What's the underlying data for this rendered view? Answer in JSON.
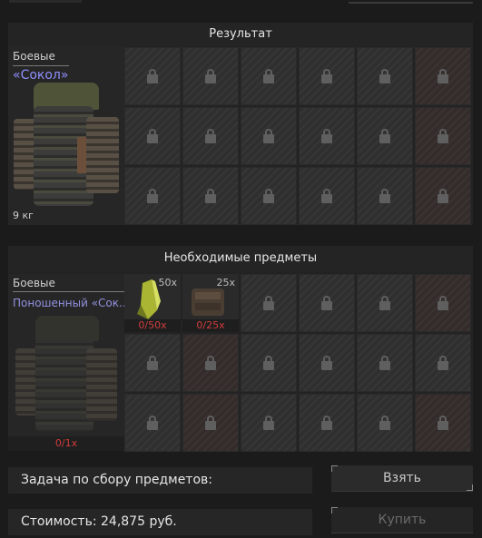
{
  "result": {
    "header": "Результат",
    "item": {
      "category": "Боевые",
      "name": "«Сокол»",
      "weight": "9 кг"
    },
    "locked_slots": 18
  },
  "required": {
    "header": "Необходимые предметы",
    "main_item": {
      "category": "Боевые",
      "name": "Поношенный «Сок..",
      "have_count": "0/1x"
    },
    "materials": [
      {
        "qty": "50x",
        "have": "0/50x",
        "icon": "crystal-material-icon",
        "color": "#b9c23a"
      },
      {
        "qty": "25x",
        "have": "0/25x",
        "icon": "brown-material-icon",
        "color": "#5a4a3c"
      }
    ]
  },
  "task": {
    "label": "Задача по сбору предметов:"
  },
  "cost": {
    "label": "Стоимость:",
    "value": "24,875",
    "currency": "руб."
  },
  "buttons": {
    "take": "Взять",
    "buy": "Купить"
  }
}
